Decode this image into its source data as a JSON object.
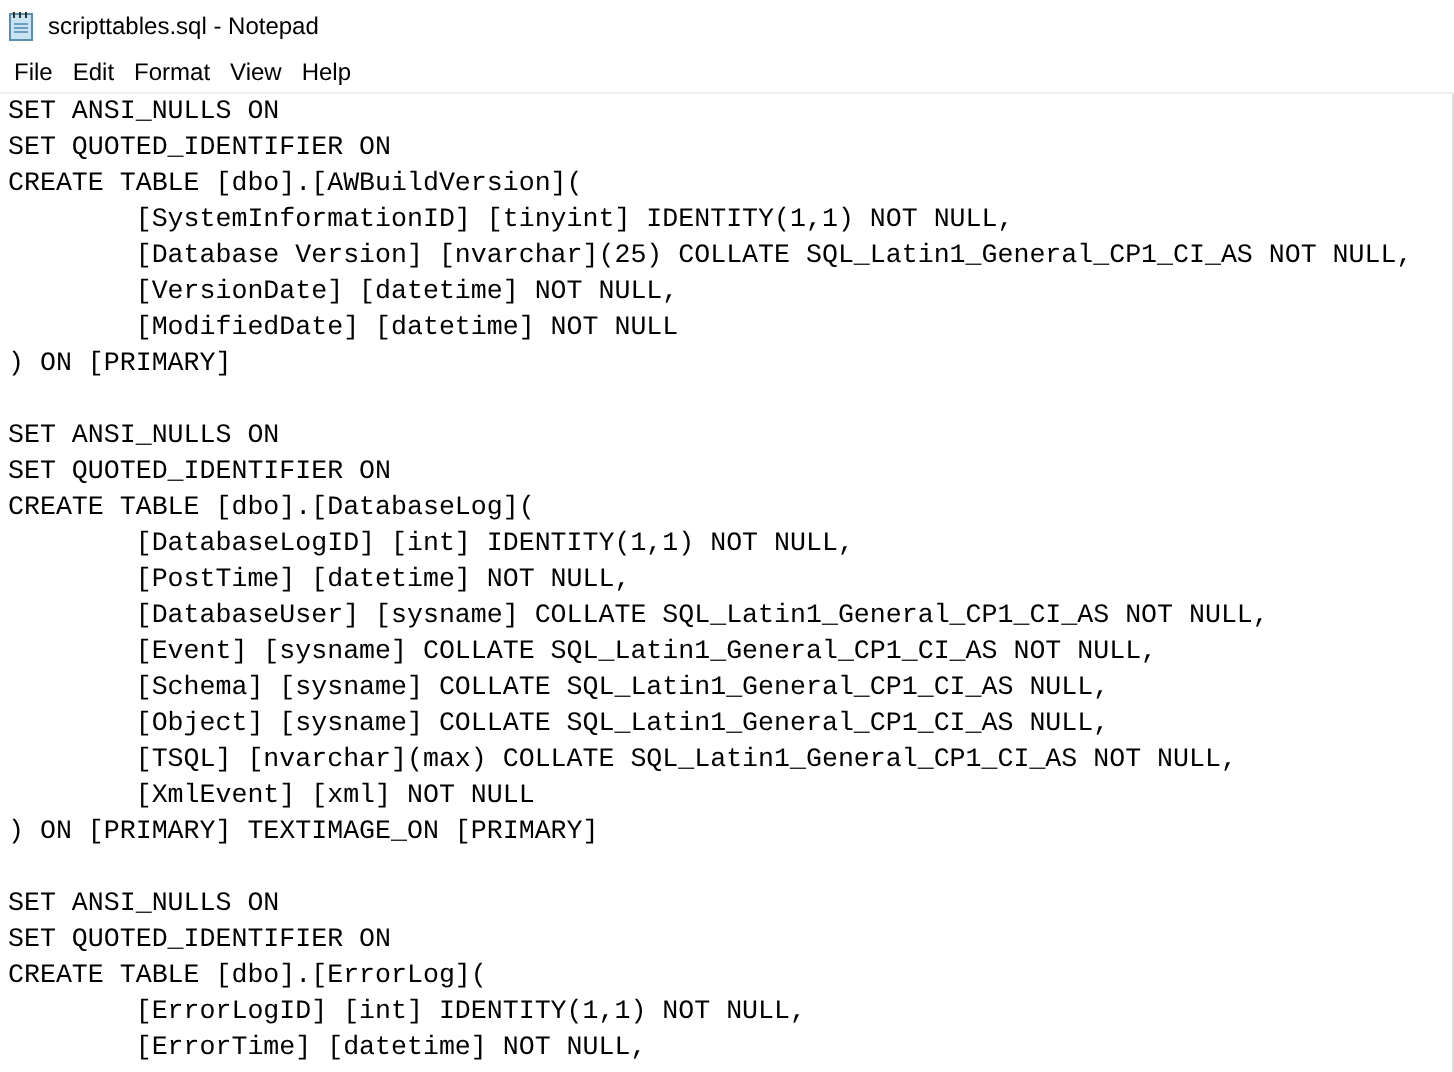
{
  "window": {
    "title": "scripttables.sql - Notepad"
  },
  "menu": [
    "File",
    "Edit",
    "Format",
    "View",
    "Help"
  ],
  "editor": {
    "blocks": [
      [
        "SET ANSI_NULLS ON",
        "SET QUOTED_IDENTIFIER ON",
        "CREATE TABLE [dbo].[AWBuildVersion](",
        "\t[SystemInformationID] [tinyint] IDENTITY(1,1) NOT NULL,",
        "\t[Database Version] [nvarchar](25) COLLATE SQL_Latin1_General_CP1_CI_AS NOT NULL,",
        "\t[VersionDate] [datetime] NOT NULL,",
        "\t[ModifiedDate] [datetime] NOT NULL",
        ") ON [PRIMARY]"
      ],
      [
        "SET ANSI_NULLS ON",
        "SET QUOTED_IDENTIFIER ON",
        "CREATE TABLE [dbo].[DatabaseLog](",
        "\t[DatabaseLogID] [int] IDENTITY(1,1) NOT NULL,",
        "\t[PostTime] [datetime] NOT NULL,",
        "\t[DatabaseUser] [sysname] COLLATE SQL_Latin1_General_CP1_CI_AS NOT NULL,",
        "\t[Event] [sysname] COLLATE SQL_Latin1_General_CP1_CI_AS NOT NULL,",
        "\t[Schema] [sysname] COLLATE SQL_Latin1_General_CP1_CI_AS NULL,",
        "\t[Object] [sysname] COLLATE SQL_Latin1_General_CP1_CI_AS NULL,",
        "\t[TSQL] [nvarchar](max) COLLATE SQL_Latin1_General_CP1_CI_AS NOT NULL,",
        "\t[XmlEvent] [xml] NOT NULL",
        ") ON [PRIMARY] TEXTIMAGE_ON [PRIMARY]"
      ],
      [
        "SET ANSI_NULLS ON",
        "SET QUOTED_IDENTIFIER ON",
        "CREATE TABLE [dbo].[ErrorLog](",
        "\t[ErrorLogID] [int] IDENTITY(1,1) NOT NULL,",
        "\t[ErrorTime] [datetime] NOT NULL,"
      ]
    ]
  }
}
